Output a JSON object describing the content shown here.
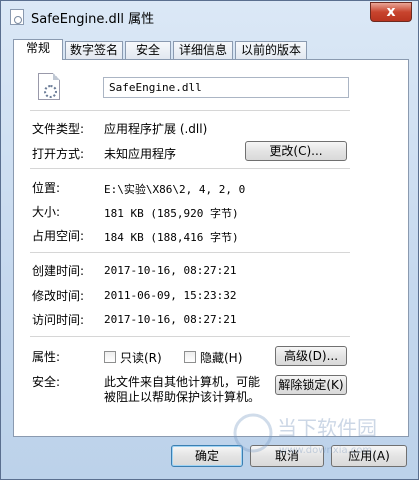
{
  "window": {
    "title": "SafeEngine.dll 属性",
    "close_glyph": "x"
  },
  "tabs": [
    "常规",
    "数字签名",
    "安全",
    "详细信息",
    "以前的版本"
  ],
  "file_name": "SafeEngine.dll",
  "rows": {
    "file_type": {
      "label": "文件类型:",
      "value": "应用程序扩展 (.dll)"
    },
    "opens_with": {
      "label": "打开方式:",
      "value": "未知应用程序",
      "button": "更改(C)..."
    },
    "location": {
      "label": "位置:",
      "value": "E:\\实验\\X86\\2, 4, 2, 0"
    },
    "size": {
      "label": "大小:",
      "value": "181 KB (185,920 字节)"
    },
    "size_on_disk": {
      "label": "占用空间:",
      "value": "184 KB (188,416 字节)"
    },
    "created": {
      "label": "创建时间:",
      "value": "2017-10-16, 08:27:21"
    },
    "modified": {
      "label": "修改时间:",
      "value": "2011-06-09, 15:23:32"
    },
    "accessed": {
      "label": "访问时间:",
      "value": "2017-10-16, 08:27:21"
    },
    "attributes": {
      "label": "属性:",
      "readonly": "只读(R)",
      "hidden": "隐藏(H)",
      "advanced": "高级(D)..."
    },
    "security": {
      "label": "安全:",
      "text_line1": "此文件来自其他计算机，可能",
      "text_line2": "被阻止以帮助保护该计算机。",
      "unblock": "解除锁定(K)"
    }
  },
  "buttons": {
    "ok": "确定",
    "cancel": "取消",
    "apply": "应用(A)"
  },
  "watermark": {
    "text_cn": "当下软件园",
    "text_en": "www.downxia.com"
  }
}
